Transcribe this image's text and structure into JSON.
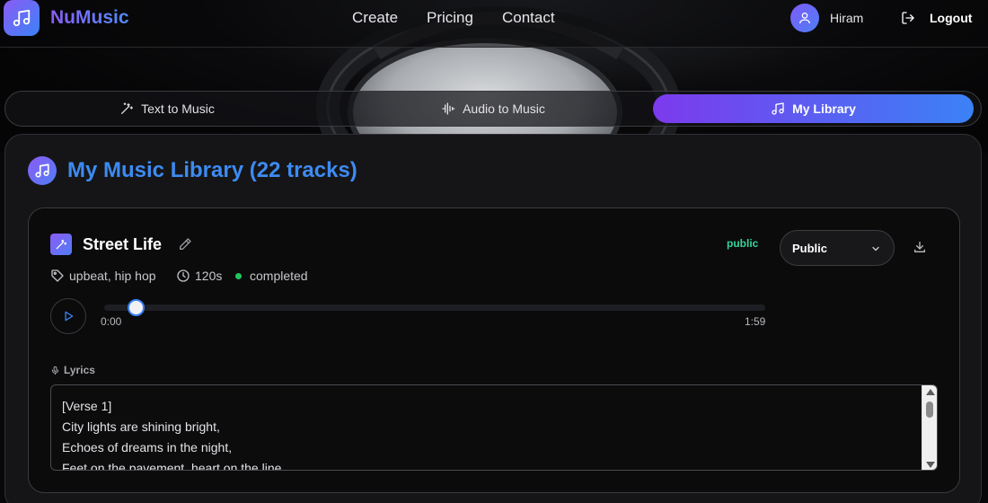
{
  "header": {
    "brand": "NuMusic",
    "nav": [
      {
        "label": "Create"
      },
      {
        "label": "Pricing"
      },
      {
        "label": "Contact"
      }
    ],
    "user": {
      "name": "Hiram"
    },
    "logout_label": "Logout"
  },
  "tabs": [
    {
      "label": "Text to Music",
      "icon": "magic-wand-icon",
      "active": false
    },
    {
      "label": "Audio to Music",
      "icon": "waveform-icon",
      "active": false
    },
    {
      "label": "My Library",
      "icon": "music-note-icon",
      "active": true
    }
  ],
  "library": {
    "title": "My Music Library (22 tracks)",
    "track": {
      "title": "Street Life",
      "visibility_badge": "public",
      "visibility_select": "Public",
      "tags": "upbeat, hip hop",
      "duration": "120s",
      "status": "completed",
      "player": {
        "current_time": "0:00",
        "total_time": "1:59",
        "progress": 0
      },
      "lyrics_label": "Lyrics",
      "lyrics": [
        "[Verse 1]",
        "City lights are shining bright,",
        "Echoes of dreams in the night,",
        "Feet on the pavement, heart on the line"
      ]
    }
  },
  "colors": {
    "accent_purple": "#8b5cf6",
    "accent_blue": "#3b82f6",
    "title_blue": "#3d8bf2",
    "status_green": "#22c55e",
    "badge_green": "#34d399"
  }
}
